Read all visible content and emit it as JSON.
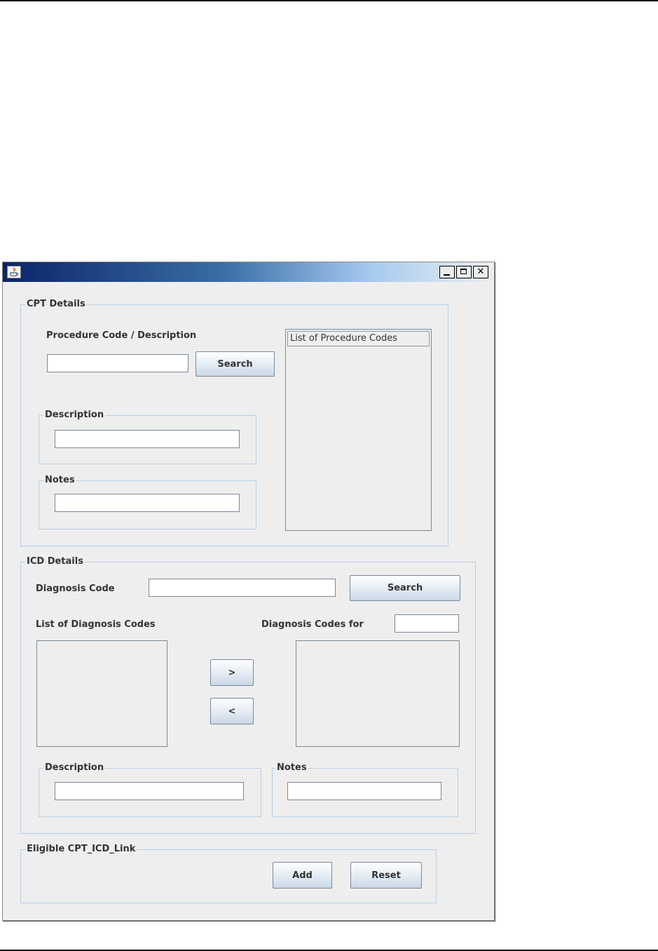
{
  "window": {
    "title": "",
    "controls": {
      "minimize": "minimize-icon",
      "maximize": "maximize-icon",
      "close": "close-icon"
    }
  },
  "cpt": {
    "group_title": "CPT Details",
    "procedure_label": "Procedure Code / Description",
    "procedure_value": "",
    "search_label": "Search",
    "list_header": "List of Procedure Codes",
    "description_title": "Description",
    "description_value": "",
    "notes_title": "Notes",
    "notes_value": ""
  },
  "icd": {
    "group_title": "ICD Details",
    "diagnosis_code_label": "Diagnosis Code",
    "diagnosis_code_value": "",
    "search_label": "Search",
    "list_label": "List of Diagnosis Codes",
    "codes_for_label": "Diagnosis Codes for",
    "codes_for_value": "",
    "add_arrow": ">",
    "remove_arrow": "<",
    "description_title": "Description",
    "description_value": "",
    "notes_title": "Notes",
    "notes_value": ""
  },
  "link": {
    "group_title": "Eligible CPT_ICD_Link",
    "add_label": "Add",
    "reset_label": "Reset"
  },
  "colors": {
    "window_bg": "#eeeeee",
    "title_gradient_start": "#0a246a",
    "group_border": "#b8cfe5",
    "label_text": "#333333"
  }
}
